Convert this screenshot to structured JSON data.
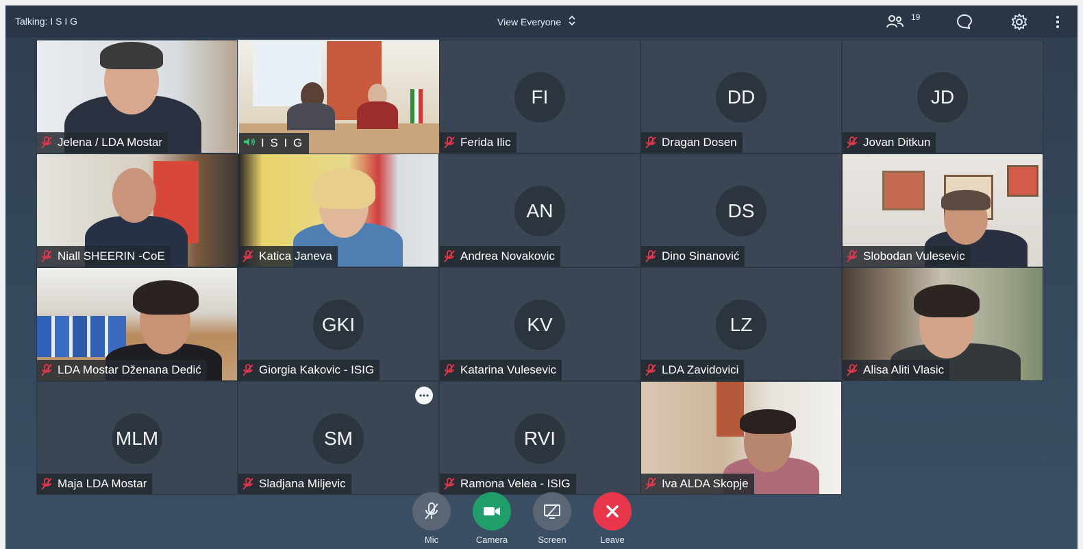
{
  "topbar": {
    "talking": "Talking: I S I G",
    "view": "View Everyone",
    "participants_count": "19"
  },
  "tiles": [
    {
      "initials": "",
      "name": "Jelena / LDA Mostar"
    },
    {
      "initials": "",
      "name": "I S I G"
    },
    {
      "initials": "FI",
      "name": "Ferida Ilic"
    },
    {
      "initials": "DD",
      "name": "Dragan Dosen"
    },
    {
      "initials": "JD",
      "name": "Jovan Ditkun"
    },
    {
      "initials": "",
      "name": "Niall SHEERIN -CoE"
    },
    {
      "initials": "",
      "name": "Katica Janeva"
    },
    {
      "initials": "AN",
      "name": "Andrea Novakovic"
    },
    {
      "initials": "DS",
      "name": "Dino Sinanović"
    },
    {
      "initials": "",
      "name": "Slobodan Vulesevic"
    },
    {
      "initials": "",
      "name": "LDA Mostar Dženana Dedić"
    },
    {
      "initials": "GKI",
      "name": "Giorgia Kakovic - ISIG"
    },
    {
      "initials": "KV",
      "name": "Katarina Vulesevic"
    },
    {
      "initials": "LZ",
      "name": "LDA Zavidovici"
    },
    {
      "initials": "",
      "name": "Alisa Aliti Vlasic"
    },
    {
      "initials": "MLM",
      "name": "Maja LDA Mostar"
    },
    {
      "initials": "SM",
      "name": "Sladjana Miljevic"
    },
    {
      "initials": "RVI",
      "name": "Ramona Velea - ISIG"
    },
    {
      "initials": "",
      "name": "Iva ALDA Skopje"
    }
  ],
  "controls": {
    "mic": "Mic",
    "camera": "Camera",
    "screen": "Screen",
    "leave": "Leave"
  },
  "colors": {
    "mic_muted": "#e8364a",
    "speaking": "#37c77a",
    "camera_on": "#1f9d6b",
    "leave": "#e8364a"
  }
}
